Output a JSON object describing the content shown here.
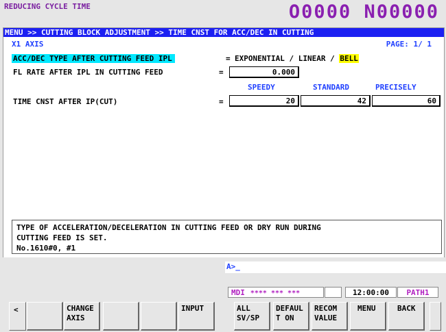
{
  "header": {
    "screen_title": "REDUCING CYCLE TIME",
    "program_number": "O0000 N00000"
  },
  "breadcrumb": "MENU >> CUTTING BLOCK ADJUSTMENT >> TIME CNST FOR ACC/DEC IN CUTTING",
  "axis": "X1  AXIS",
  "page": "PAGE: 1/ 1",
  "params": {
    "acc_dec_type": {
      "label": "ACC/DEC TYPE AFTER CUTTING FEED IPL",
      "equals": "=",
      "options_text": "EXPONENTIAL / LINEAR / ",
      "selected": "BELL"
    },
    "fl_rate": {
      "label": "FL RATE AFTER IPL IN CUTTING FEED",
      "equals": "=",
      "value": "0.000"
    },
    "columns": [
      "SPEEDY",
      "STANDARD",
      "PRECISELY"
    ],
    "time_cnst": {
      "label": "TIME CNST AFTER IP(CUT)",
      "equals": "=",
      "speedy": "20",
      "standard": "42",
      "precisely": "60"
    }
  },
  "help": {
    "line1": "TYPE OF ACCELERATION/DECELERATION IN CUTTING FEED OR DRY RUN DURING",
    "line2": "CUTTING FEED IS SET.",
    "line3": "No.1610#0, #1"
  },
  "key_input": "A>_",
  "status": {
    "mode": "MDI",
    "stars": "**** *** ***",
    "time": "12:00:00",
    "path": "PATH1"
  },
  "softkeys": {
    "left_arrow": "<",
    "k1": "",
    "k2_line1": "CHANGE",
    "k2_line2": "AXIS",
    "k3": "",
    "k4": "",
    "k5": "INPUT",
    "k6_line1": "ALL",
    "k6_line2": "SV/SP",
    "k7_line1": "DEFAUL",
    "k7_line2": "T ON",
    "k8_line1": "RECOM",
    "k8_line2": "VALUE",
    "k9": "MENU",
    "k10": "BACK"
  }
}
